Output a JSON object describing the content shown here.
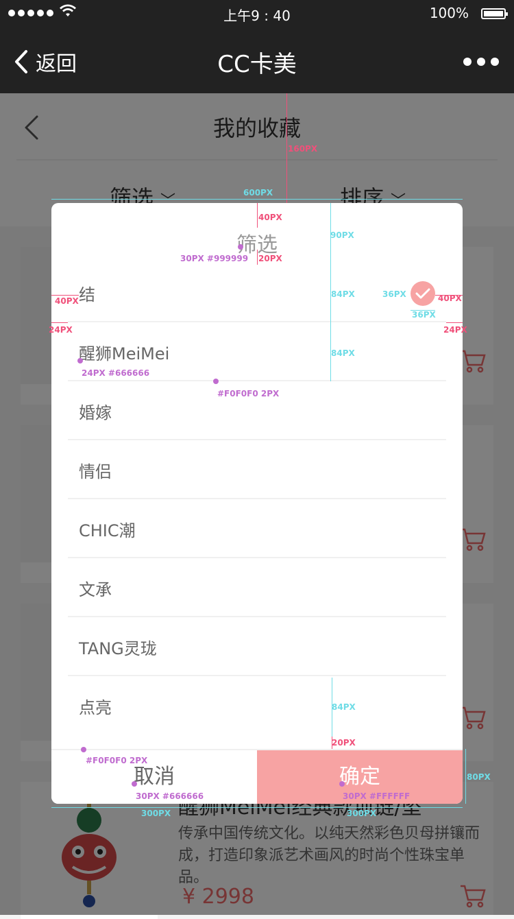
{
  "status_bar": {
    "time": "上午9 : 40",
    "battery": "100%"
  },
  "nav": {
    "back_label": "返回",
    "title": "CC卡美"
  },
  "page": {
    "title": "我的收藏",
    "filter_label": "筛选",
    "sort_label": "排序"
  },
  "products": [
    {
      "title": "醒狮MeiMei经典款项链/坠",
      "desc": "传承中国传统文化。以纯天然彩色贝母拼镶而成，打造印象派艺术画风的时尚个性珠宝单品。",
      "price": "¥ 2998"
    }
  ],
  "modal": {
    "title": "筛选",
    "options": [
      {
        "label": "结",
        "selected": true
      },
      {
        "label": "醒狮MeiMei",
        "selected": false
      },
      {
        "label": "婚嫁",
        "selected": false
      },
      {
        "label": "情侣",
        "selected": false
      },
      {
        "label": "CHIC潮",
        "selected": false
      },
      {
        "label": "文承",
        "selected": false
      },
      {
        "label": "TANG灵珑",
        "selected": false
      },
      {
        "label": "点亮",
        "selected": false
      }
    ],
    "cancel_label": "取消",
    "confirm_label": "确定"
  },
  "annotations": {
    "a160": "160PX",
    "a600": "600PX",
    "a40top": "40PX",
    "a90": "90PX",
    "a_title_spec": "30PX #999999",
    "a20": "20PX",
    "a84a": "84PX",
    "a36left": "36PX",
    "a40left": "40PX",
    "a40right": "40PX",
    "a24left": "24PX",
    "a36bottom": "36PX",
    "a24right": "24PX",
    "a84b": "84PX",
    "a_opt_spec": "24PX #666666",
    "a_line_spec": "#F0F0F0 2PX",
    "a84c": "84PX",
    "a20b": "20PX",
    "a_line_spec2": "#F0F0F0 2PX",
    "a80": "80PX",
    "a_cancel_spec": "30PX #666666",
    "a_ok_spec": "30PX #FFFFFF",
    "a300l": "300PX",
    "a300r": "300PX"
  },
  "colors": {
    "accent": "#f7a3a3",
    "price": "#ef6b6b",
    "annotation_cyan": "#6fdce6",
    "annotation_pink": "#f0507a",
    "annotation_purple": "#c06ccf"
  }
}
